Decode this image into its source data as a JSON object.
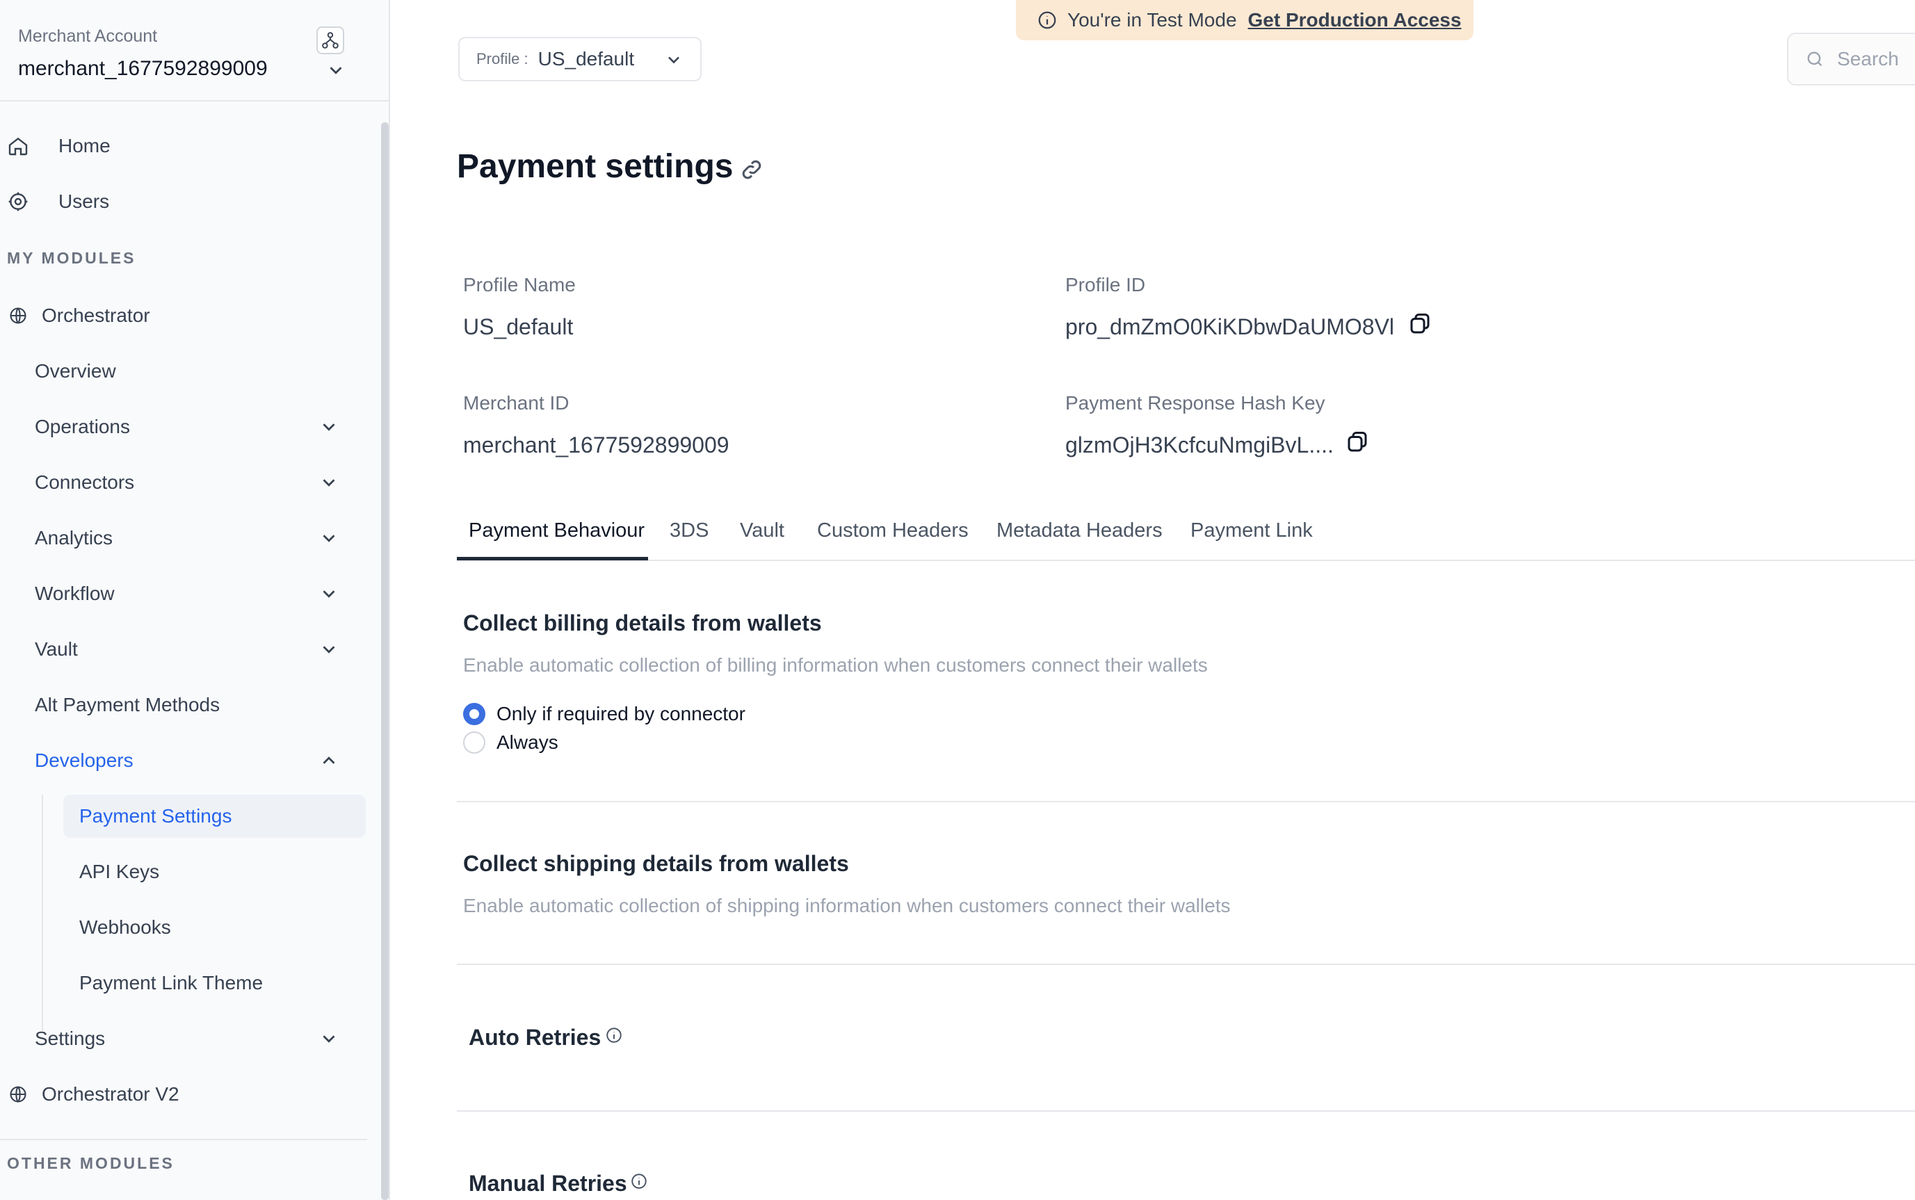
{
  "sidebar": {
    "account_label": "Merchant Account",
    "account_name": "merchant_1677592899009",
    "nav": {
      "home": "Home",
      "users": "Users"
    },
    "my_modules_title": "MY MODULES",
    "orchestrator": "Orchestrator",
    "items": {
      "overview": "Overview",
      "operations": "Operations",
      "connectors": "Connectors",
      "analytics": "Analytics",
      "workflow": "Workflow",
      "vault": "Vault",
      "alt_payment_methods": "Alt Payment Methods",
      "developers": "Developers",
      "payment_settings": "Payment Settings",
      "api_keys": "API Keys",
      "webhooks": "Webhooks",
      "payment_link_theme": "Payment Link Theme",
      "settings": "Settings"
    },
    "orchestrator_v2": "Orchestrator V2",
    "other_modules_title": "OTHER MODULES"
  },
  "topbar": {
    "profile_label": "Profile :",
    "profile_value": "US_default",
    "test_mode_text": "You're in Test Mode",
    "test_mode_link": "Get Production Access",
    "search_placeholder": "Search"
  },
  "main": {
    "title": "Payment settings",
    "fields": {
      "profile_name_label": "Profile Name",
      "profile_name_value": "US_default",
      "profile_id_label": "Profile ID",
      "profile_id_value": "pro_dmZmO0KiKDbwDaUMO8Vl",
      "merchant_id_label": "Merchant ID",
      "merchant_id_value": "merchant_1677592899009",
      "hash_key_label": "Payment Response Hash Key",
      "hash_key_value": "glzmOjH3KcfcuNmgiBvL...."
    },
    "tabs": [
      "Payment Behaviour",
      "3DS",
      "Vault",
      "Custom Headers",
      "Metadata Headers",
      "Payment Link"
    ],
    "billing": {
      "title": "Collect billing details from wallets",
      "description": "Enable automatic collection of billing information when customers connect their wallets",
      "option_1": "Only if required by connector",
      "option_2": "Always",
      "selected": "Only if required by connector"
    },
    "shipping": {
      "title": "Collect shipping details from wallets",
      "description": "Enable automatic collection of shipping information when customers connect their wallets"
    },
    "auto_retries": "Auto Retries",
    "manual_retries": "Manual Retries"
  },
  "colors": {
    "accent": "#2563eb",
    "radio_selected": "#3b6fe0",
    "banner_bg": "#fbe9d3"
  }
}
